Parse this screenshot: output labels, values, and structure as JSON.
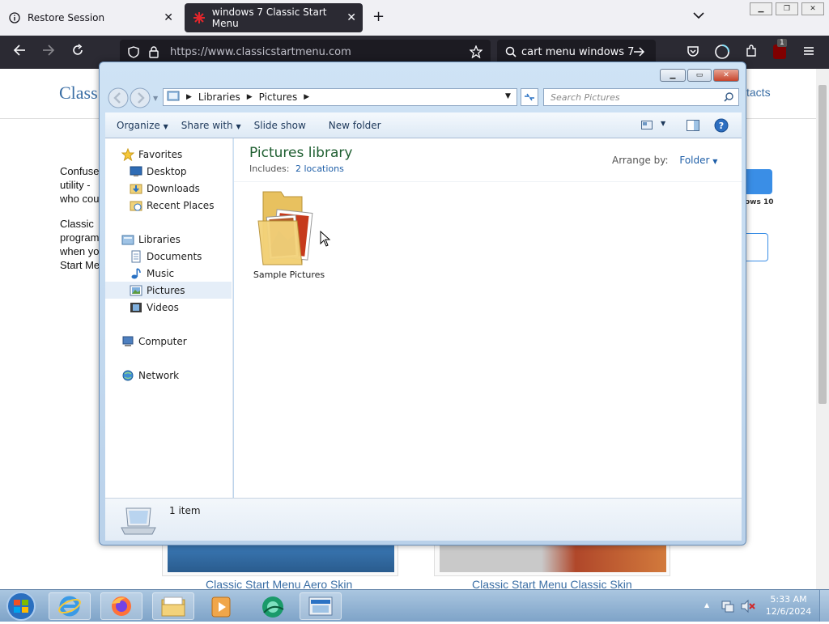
{
  "browser": {
    "tabs": [
      {
        "title": "Restore Session"
      },
      {
        "title": "windows 7 Classic Start Menu"
      }
    ],
    "url": "https://www.classicstartmenu.com",
    "search_text": "cart menu windows 7",
    "addon_badge": "1"
  },
  "webpage": {
    "brand": "Class",
    "nav_right": "tacts",
    "para1": [
      "Confuse",
      "utility -",
      "who cou"
    ],
    "para2": [
      "Classic",
      "program",
      "when yo",
      "Start Me"
    ],
    "side_note": "ows 10",
    "captions": [
      "Classic Start Menu Aero Skin",
      "Classic Start Menu Classic Skin"
    ]
  },
  "explorer": {
    "breadcrumb": [
      "Libraries",
      "Pictures"
    ],
    "search_placeholder": "Search Pictures",
    "toolbar": {
      "organize": "Organize",
      "share_with": "Share with",
      "slide_show": "Slide show",
      "new_folder": "New folder"
    },
    "nav": {
      "favorites": "Favorites",
      "favorites_items": [
        "Desktop",
        "Downloads",
        "Recent Places"
      ],
      "libraries": "Libraries",
      "libraries_items": [
        "Documents",
        "Music",
        "Pictures",
        "Videos"
      ],
      "computer": "Computer",
      "network": "Network"
    },
    "library_title": "Pictures library",
    "includes_label": "Includes:",
    "includes_link": "2 locations",
    "arrange_label": "Arrange by:",
    "arrange_value": "Folder",
    "items": [
      {
        "name": "Sample Pictures"
      }
    ],
    "status": "1 item"
  },
  "taskbar": {
    "time": "5:33 AM",
    "date": "12/6/2024"
  }
}
